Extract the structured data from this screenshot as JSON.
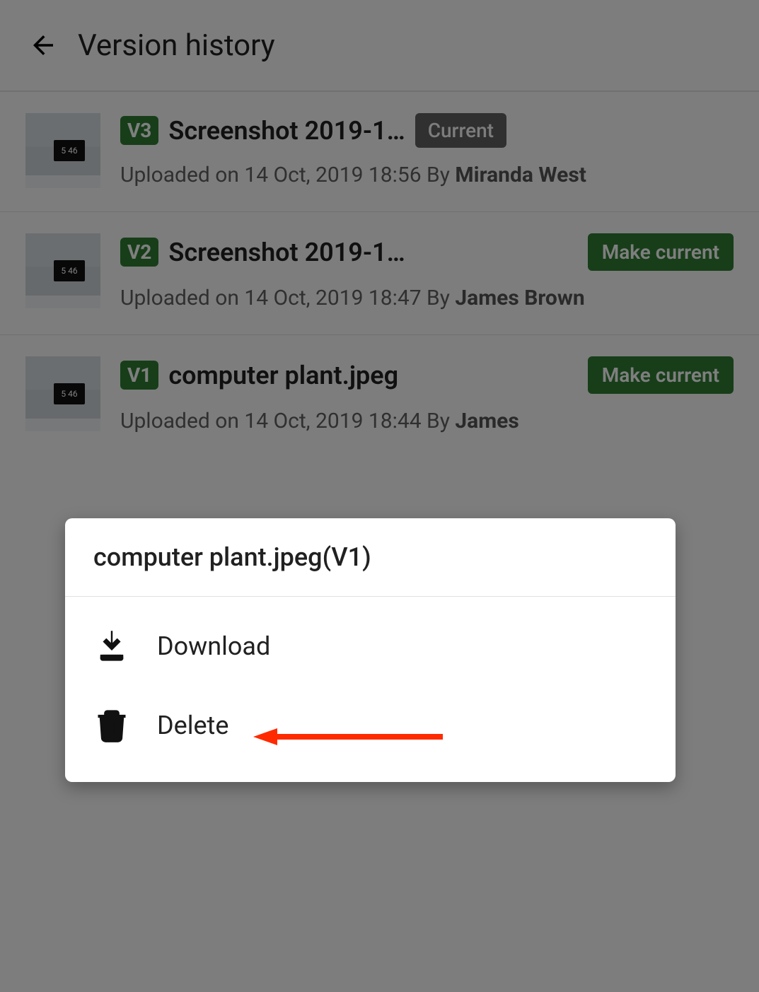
{
  "header": {
    "title": "Version history"
  },
  "versions": [
    {
      "badge": "V3",
      "filename": "Screenshot 2019-1…",
      "status": "Current",
      "action": null,
      "uploaded_prefix": "Uploaded on ",
      "uploaded_date": "14 Oct, 2019 18:56",
      "by_label": " By ",
      "author": "Miranda West"
    },
    {
      "badge": "V2",
      "filename": "Screenshot 2019-1…",
      "status": null,
      "action": "Make current",
      "uploaded_prefix": "Uploaded on ",
      "uploaded_date": "14 Oct, 2019 18:47",
      "by_label": " By ",
      "author": "James Brown"
    },
    {
      "badge": "V1",
      "filename": "computer plant.jpeg",
      "status": null,
      "action": "Make current",
      "uploaded_prefix": "Uploaded on ",
      "uploaded_date": "14 Oct, 2019 18:44",
      "by_label": " By ",
      "author": "James"
    }
  ],
  "sheet": {
    "title": "computer plant.jpeg(V1)",
    "items": [
      {
        "label": "Download"
      },
      {
        "label": "Delete"
      }
    ]
  }
}
